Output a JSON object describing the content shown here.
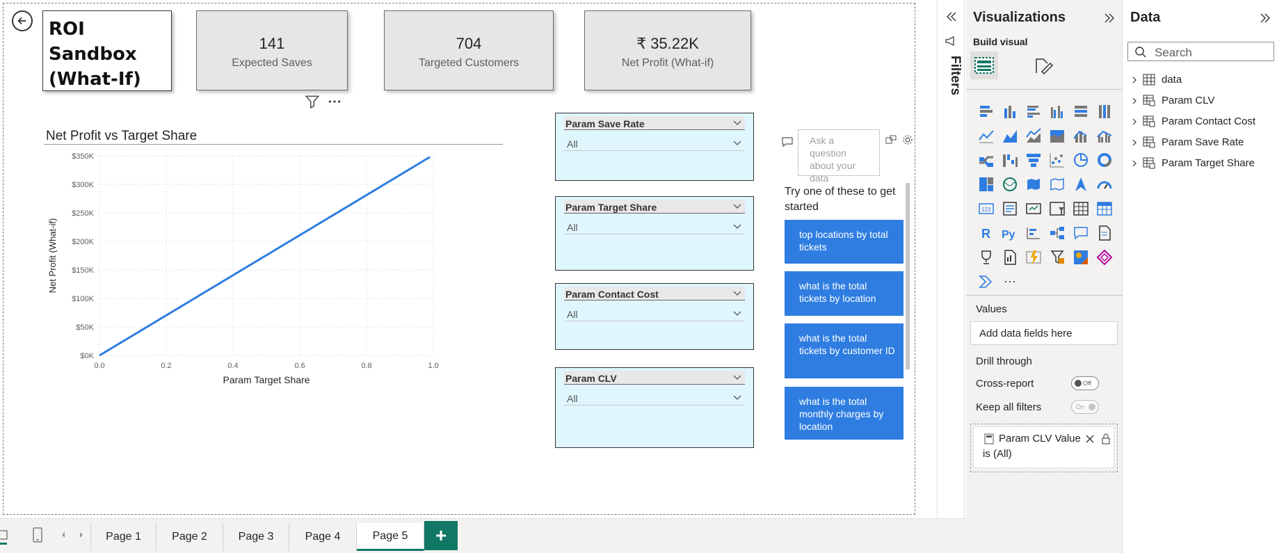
{
  "report": {
    "title": "ROI Sandbox (What-If)",
    "kpis": [
      {
        "value": "141",
        "label": "Expected Saves"
      },
      {
        "value": "704",
        "label": "Targeted Customers"
      },
      {
        "value": "₹ 35.22K",
        "label": "Net Profit (What-if)"
      }
    ],
    "chart": {
      "title": "Net Profit vs Target Share",
      "xlabel": "Param Target Share",
      "ylabel": "Net Profit (What-if)",
      "x_ticks": [
        "0.0",
        "0.2",
        "0.4",
        "0.6",
        "0.8",
        "1.0"
      ],
      "y_ticks": [
        "$0K",
        "$50K",
        "$100K",
        "$150K",
        "$200K",
        "$250K",
        "$300K",
        "$350K"
      ]
    },
    "slicers": [
      {
        "title": "Param Save Rate",
        "value": "All"
      },
      {
        "title": "Param Target Share",
        "value": "All"
      },
      {
        "title": "Param Contact Cost",
        "value": "All"
      },
      {
        "title": "Param CLV",
        "value": "All"
      }
    ],
    "qa": {
      "placeholder": "Ask a question about your data",
      "try_text": "Try one of these to get started",
      "suggestions": [
        "top locations by total tickets",
        "what is the total tickets by location",
        "what is the total tickets by customer ID",
        "what is the total monthly charges by location"
      ]
    }
  },
  "chart_data": {
    "type": "line",
    "title": "Net Profit vs Target Share",
    "xlabel": "Param Target Share",
    "ylabel": "Net Profit (What-if)",
    "xlim": [
      0,
      1
    ],
    "ylim": [
      0,
      350000
    ],
    "grid": true,
    "series": [
      {
        "x": [
          0.0,
          0.99
        ],
        "y": [
          0,
          348000
        ]
      }
    ]
  },
  "pages": {
    "tabs": [
      "Page 1",
      "Page 2",
      "Page 3",
      "Page 4",
      "Page 5"
    ],
    "active": "Page 5",
    "add_label": "+"
  },
  "filters": {
    "label": "Filters"
  },
  "visualizations": {
    "title": "Visualizations",
    "build_visual": "Build visual",
    "values_label": "Values",
    "add_fields": "Add data fields here",
    "drill_through": "Drill through",
    "cross_report": "Cross-report",
    "cross_report_state": "Off",
    "keep_all_filters": "Keep all filters",
    "keep_all_state": "On",
    "filter_card": {
      "name": "Param CLV Value",
      "state": "is (All)"
    },
    "more": "···"
  },
  "data_pane": {
    "title": "Data",
    "search_placeholder": "Search",
    "items": [
      "data",
      "Param CLV",
      "Param Contact Cost",
      "Param Save Rate",
      "Param Target Share"
    ]
  },
  "colors": {
    "accent": "#117865",
    "line": "#2f7de1",
    "slicer_bg": "#dff6fd",
    "qa_button": "#2f7de1"
  }
}
